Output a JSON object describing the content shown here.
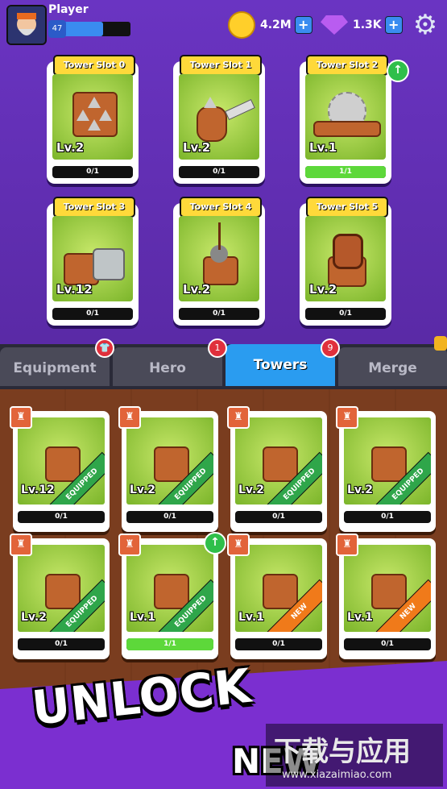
{
  "player": {
    "name": "Player",
    "level": "47",
    "xp_fraction": 0.66
  },
  "resources": {
    "coins": "4.2M",
    "gems": "1.3K"
  },
  "slots": [
    {
      "title": "Tower Slot 0",
      "level": "Lv.2",
      "progress": "0/1",
      "fill": 0
    },
    {
      "title": "Tower Slot 1",
      "level": "Lv.2",
      "progress": "0/1",
      "fill": 0
    },
    {
      "title": "Tower Slot 2",
      "level": "Lv.1",
      "progress": "1/1",
      "fill": 1
    },
    {
      "title": "Tower Slot 3",
      "level": "Lv.12",
      "progress": "0/1",
      "fill": 0
    },
    {
      "title": "Tower Slot 4",
      "level": "Lv.2",
      "progress": "0/1",
      "fill": 0
    },
    {
      "title": "Tower Slot 5",
      "level": "Lv.2",
      "progress": "0/1",
      "fill": 0
    }
  ],
  "tabs": [
    {
      "label": "Equipment",
      "badge": ""
    },
    {
      "label": "Hero",
      "badge": "1"
    },
    {
      "label": "Towers",
      "badge": "9"
    },
    {
      "label": "Merge",
      "badge": ""
    }
  ],
  "cards": [
    {
      "level": "Lv.12",
      "progress": "0/1",
      "fill": 0,
      "ribbon": "EQUIPPED"
    },
    {
      "level": "Lv.2",
      "progress": "0/1",
      "fill": 0,
      "ribbon": "EQUIPPED"
    },
    {
      "level": "Lv.2",
      "progress": "0/1",
      "fill": 0,
      "ribbon": "EQUIPPED"
    },
    {
      "level": "Lv.2",
      "progress": "0/1",
      "fill": 0,
      "ribbon": "EQUIPPED"
    },
    {
      "level": "Lv.2",
      "progress": "0/1",
      "fill": 0,
      "ribbon": "EQUIPPED"
    },
    {
      "level": "Lv.1",
      "progress": "1/1",
      "fill": 1,
      "ribbon": "EQUIPPED"
    },
    {
      "level": "Lv.1",
      "progress": "0/1",
      "fill": 0,
      "ribbon": "NEW"
    },
    {
      "level": "Lv.1",
      "progress": "0/1",
      "fill": 0,
      "ribbon": "NEW"
    }
  ],
  "banner": {
    "line1": "UNLOCK",
    "line2": "NEW"
  },
  "watermark": {
    "main": "下载与应用",
    "url": "www.xiazaimiao.com"
  }
}
